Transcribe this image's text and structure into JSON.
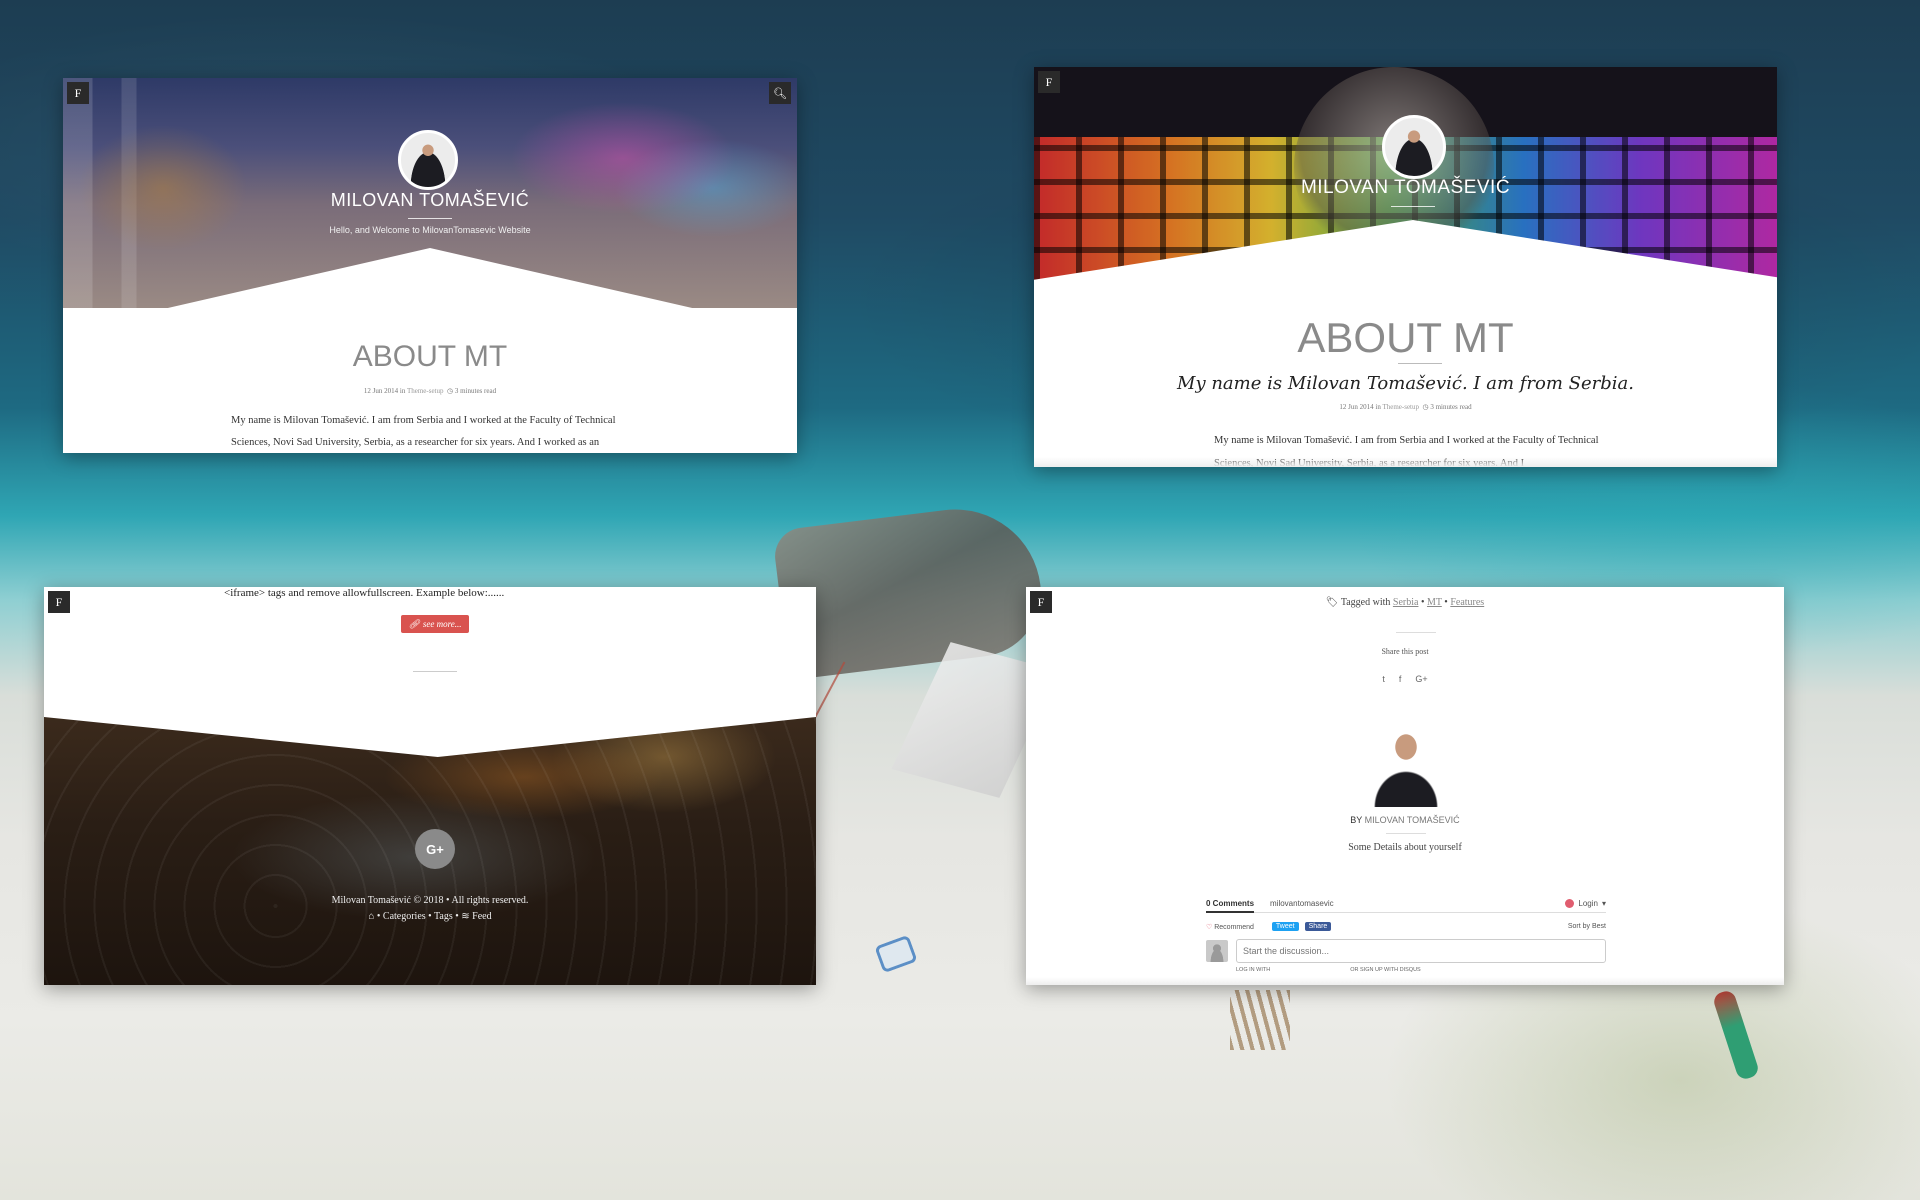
{
  "shot1": {
    "badge": "F",
    "search_icon": "search-icon",
    "hero_title": "MILOVAN TOMAŠEVIĆ",
    "hero_subtitle": "Hello, and Welcome to MilovanTomasevic Website",
    "page_title": "ABOUT MT",
    "meta_date": "12 Jun 2014 in",
    "meta_category": "Theme-setup",
    "meta_readtime": "3 minutes read",
    "paragraph": "My name is Milovan Tomašević. I am from Serbia and I worked at the Faculty of Technical Sciences, Novi Sad University, Serbia, as a researcher for six years. And I worked as an"
  },
  "shot2": {
    "badge": "F",
    "hero_title": "MILOVAN TOMAŠEVIĆ",
    "page_title": "ABOUT MT",
    "subtitle": "My name is Milovan Tomašević. I am from Serbia.",
    "meta_date": "12 Jun 2014 in",
    "meta_category": "Theme-setup",
    "meta_readtime": "3 minutes read",
    "paragraph": "My name is Milovan Tomašević. I am from Serbia and I worked at the Faculty of Technical Sciences, Novi Sad University, Serbia, as a researcher for six years. And I"
  },
  "shot3": {
    "badge": "F",
    "iframe_text": "<iframe> tags and remove allowfullscreen. Example below:......",
    "see_more": "see more...",
    "gplus": "G+",
    "copyright": "Milovan Tomašević © 2018 • All rights reserved.",
    "links": {
      "categories": "Categories",
      "tags": "Tags",
      "feed": "Feed",
      "sep": "•"
    }
  },
  "shot4": {
    "badge": "F",
    "tagged_with": "Tagged with",
    "tags": [
      "Serbia",
      "MT",
      "Features"
    ],
    "sep": "•",
    "share": "Share this post",
    "social": {
      "twitter": "t",
      "facebook": "f",
      "google": "G+"
    },
    "by": "BY",
    "author": "MILOVAN TOMAŠEVIĆ",
    "details": "Some Details about yourself",
    "disqus": {
      "comments": "0 Comments",
      "site": "milovantomasevic",
      "login": "Login",
      "recommend": "Recommend",
      "tweet": "Tweet",
      "share": "Share",
      "sort": "Sort by Best",
      "placeholder": "Start the discussion...",
      "log_in_with": "LOG IN WITH",
      "sign_up": "OR SIGN UP WITH DISQUS"
    }
  }
}
